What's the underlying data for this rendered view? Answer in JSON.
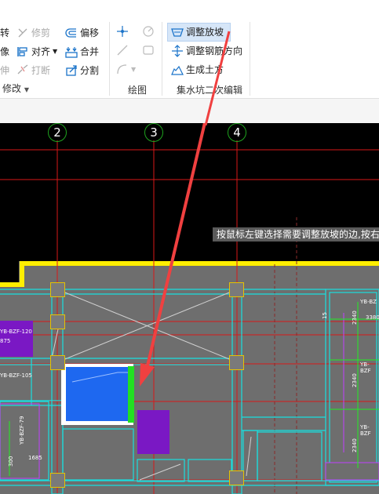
{
  "ribbon": {
    "modify_group": {
      "rotate_label": "转",
      "trim_label": "修剪",
      "offset_label": "偏移",
      "mirror_label": "像",
      "align_label": "对齐",
      "merge_label": "合并",
      "stretch_label": "伸",
      "break_label": "打断",
      "split_label": "分割",
      "group_label": "修改"
    },
    "draw_group": {
      "group_label": "绘图"
    },
    "sump_group": {
      "adjust_slope_label": "调整放坡",
      "adjust_rebar_label": "调整钢筋方向",
      "gen_earthwork_label": "生成土方",
      "group_label": "集水坑二次编辑"
    }
  },
  "canvas": {
    "tooltip": "按鼠标左键选择需要调整放坡的边,按右",
    "axes": [
      "2",
      "3",
      "4"
    ],
    "labels": {
      "l1": "YB-BZF-120",
      "l2": "875",
      "l3": "YB-BZF-105",
      "l4": "YB-BZF-79",
      "l5": "300",
      "l6": "1685",
      "r1": "YB-BZ",
      "r2": "2340",
      "r3": "3380",
      "r4": "YB-BZF",
      "r5": "2340",
      "r6": "YB-BZF",
      "r7": "2340",
      "n15": "15"
    }
  },
  "colors": {
    "accent": "#1a73c9",
    "canvas_bg": "#000000",
    "fill_gray": "#6e6e6e",
    "grid_red": "#d81818",
    "cyan": "#19e0e0"
  }
}
